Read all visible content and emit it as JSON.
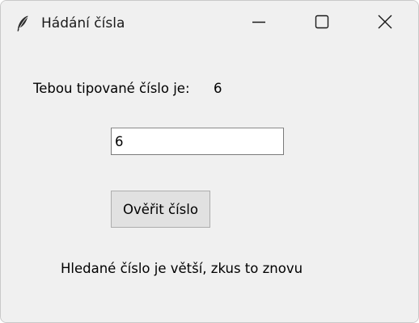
{
  "window": {
    "title": "Hádání čísla",
    "icon": "feather-icon",
    "controls": {
      "minimize": "minimize-icon",
      "maximize": "maximize-icon",
      "close": "close-icon"
    }
  },
  "form": {
    "guess_label": "Tebou tipované číslo je:",
    "guess_value": "6",
    "entry_value": "6",
    "verify_button_label": "Ověřit číslo",
    "result_text": "Hledané číslo je větší, zkus to znovu"
  }
}
